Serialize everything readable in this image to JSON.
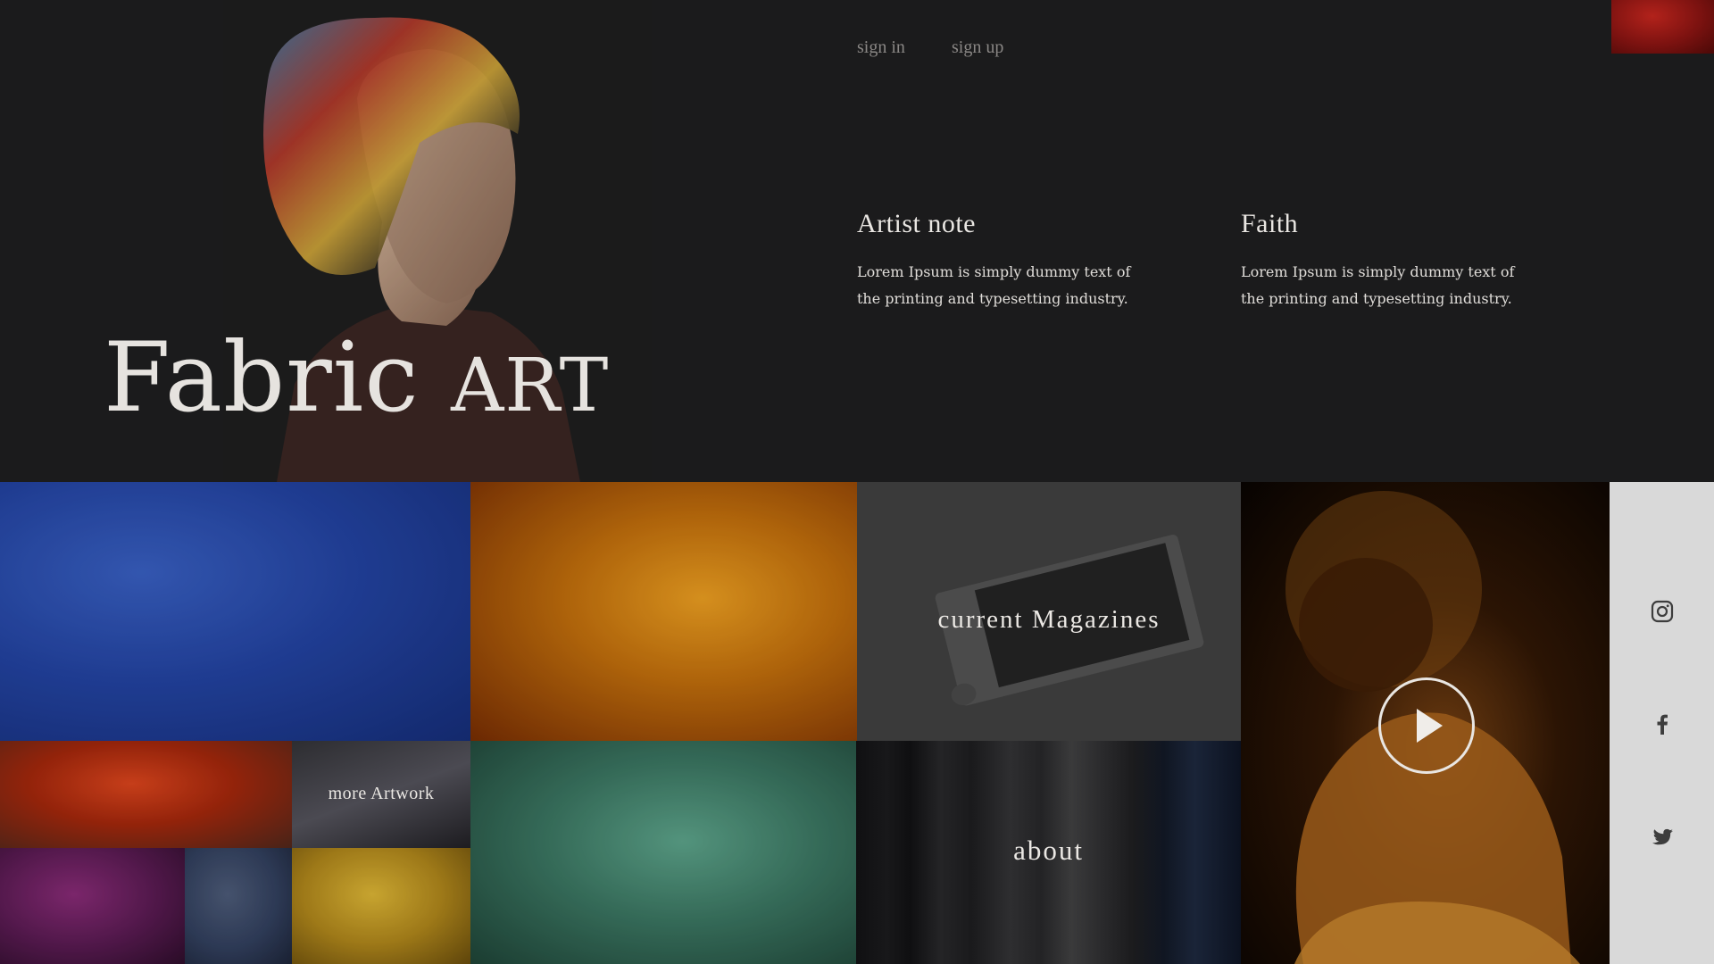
{
  "header": {
    "title_main": "Fabric",
    "title_caps": "ART",
    "sign_in": "sign in",
    "sign_up": "sign up"
  },
  "notes": [
    {
      "heading": "Artist note",
      "body": "Lorem Ipsum is simply dummy text of the printing and typesetting industry."
    },
    {
      "heading": "Faith",
      "body": "Lorem Ipsum is simply dummy text of the printing and typesetting industry."
    }
  ],
  "tiles": {
    "magazines_label": "current Magazines",
    "more_artwork_label": "more Artwork",
    "about_label": "about"
  },
  "social": {
    "icons": [
      "instagram-icon",
      "facebook-icon",
      "twitter-icon"
    ]
  },
  "video": {
    "icon": "play-icon"
  }
}
